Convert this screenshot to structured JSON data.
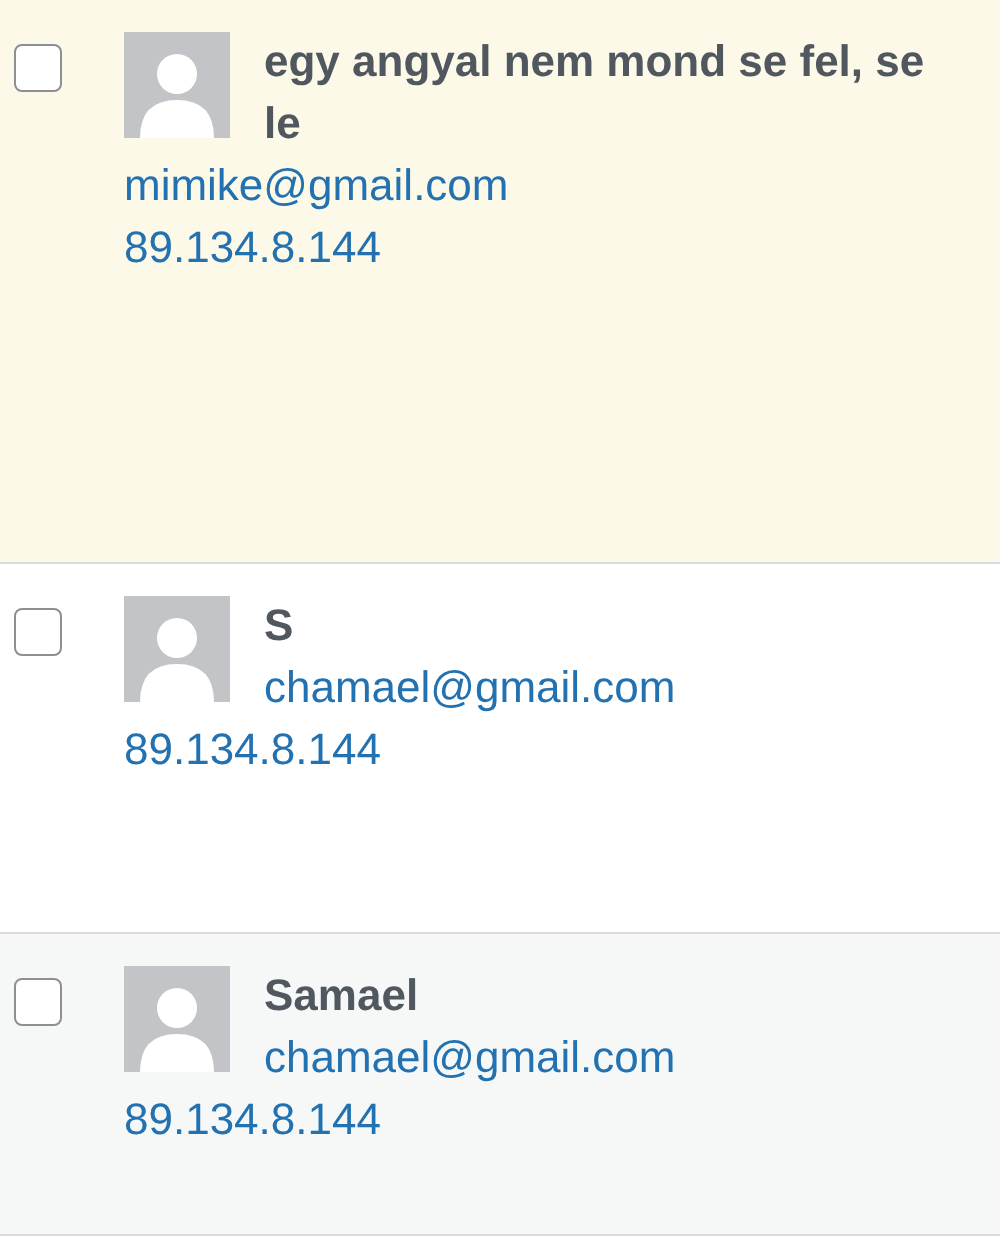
{
  "comments": [
    {
      "kind": "unapproved",
      "checked": false,
      "author": "egy angyal nem mond se fel, se le",
      "email": "mimike@gmail.com",
      "ip": "89.134.8.144"
    },
    {
      "kind": "approved",
      "checked": false,
      "author": "S",
      "email": "chamael@gmail.com",
      "ip": "89.134.8.144"
    },
    {
      "kind": "approved",
      "checked": false,
      "author": "Samael",
      "email": "chamael@gmail.com",
      "ip": "89.134.8.144"
    }
  ]
}
